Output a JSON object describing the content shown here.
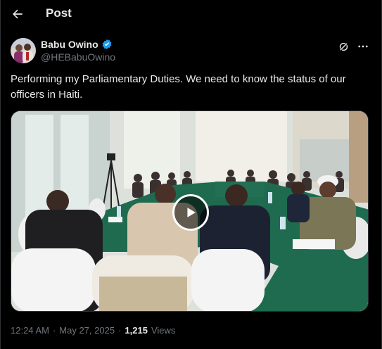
{
  "header": {
    "title": "Post",
    "back_icon": "arrow-left-icon"
  },
  "author": {
    "display_name": "Babu Owino",
    "handle": "@HEBabuOwino",
    "verified": true,
    "verified_color": "#1d9bf0"
  },
  "post": {
    "text": "Performing my Parliamentary Duties. We need to know the status of our officers in Haiti."
  },
  "media": {
    "type": "video",
    "play_icon": "play-icon"
  },
  "meta": {
    "time": "12:24 AM",
    "separator": "·",
    "date": "May 27, 2025",
    "views_count": "1,215",
    "views_label": "Views"
  },
  "colors": {
    "background": "#000000",
    "text_primary": "#e7e9ea",
    "text_secondary": "#71767b",
    "accent": "#1d9bf0"
  }
}
